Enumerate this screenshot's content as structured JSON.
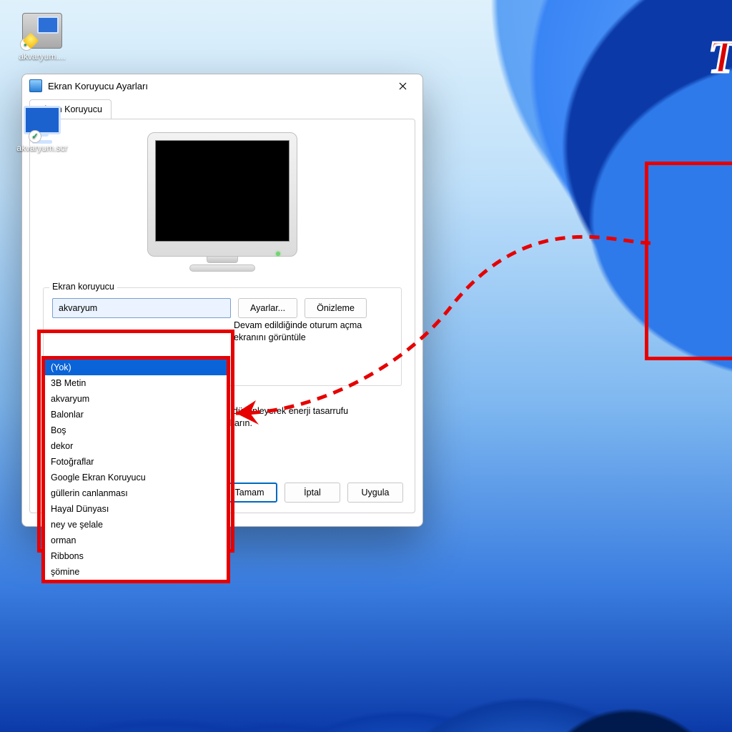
{
  "colors": {
    "accentRed": "#e60000",
    "highlightBlue": "#0a64d8"
  },
  "dialog": {
    "title": "Ekran Koruyucu Ayarları",
    "tab": "Ekran Koruyucu",
    "groupLegend": "Ekran koruyucu",
    "selected": "akvaryum",
    "settingsBtn": "Ayarlar...",
    "previewBtn": "Önizleme",
    "resumeText1": "Devam edildiğinde oturum açma",
    "resumeText2": "ekranını görüntüle",
    "powerText1": "nı düzenleyerek enerji tasarrufu",
    "powerText2": "çıkarın.",
    "options": [
      "(Yok)",
      "3B Metin",
      "akvaryum",
      "Balonlar",
      "Boş",
      "dekor",
      "Fotoğraflar",
      "Google Ekran Koruyucu",
      "güllerin canlanması",
      "Hayal Dünyası",
      "ney ve şelale",
      "orman",
      "Ribbons",
      "şömine"
    ],
    "highlightedIndex": 0,
    "ok": "Tamam",
    "cancel": "İptal",
    "apply": "Uygula"
  },
  "desktop": {
    "icon1": "akvaryum....",
    "icon2": "akvaryum.scr"
  },
  "accentGlyph": "T"
}
